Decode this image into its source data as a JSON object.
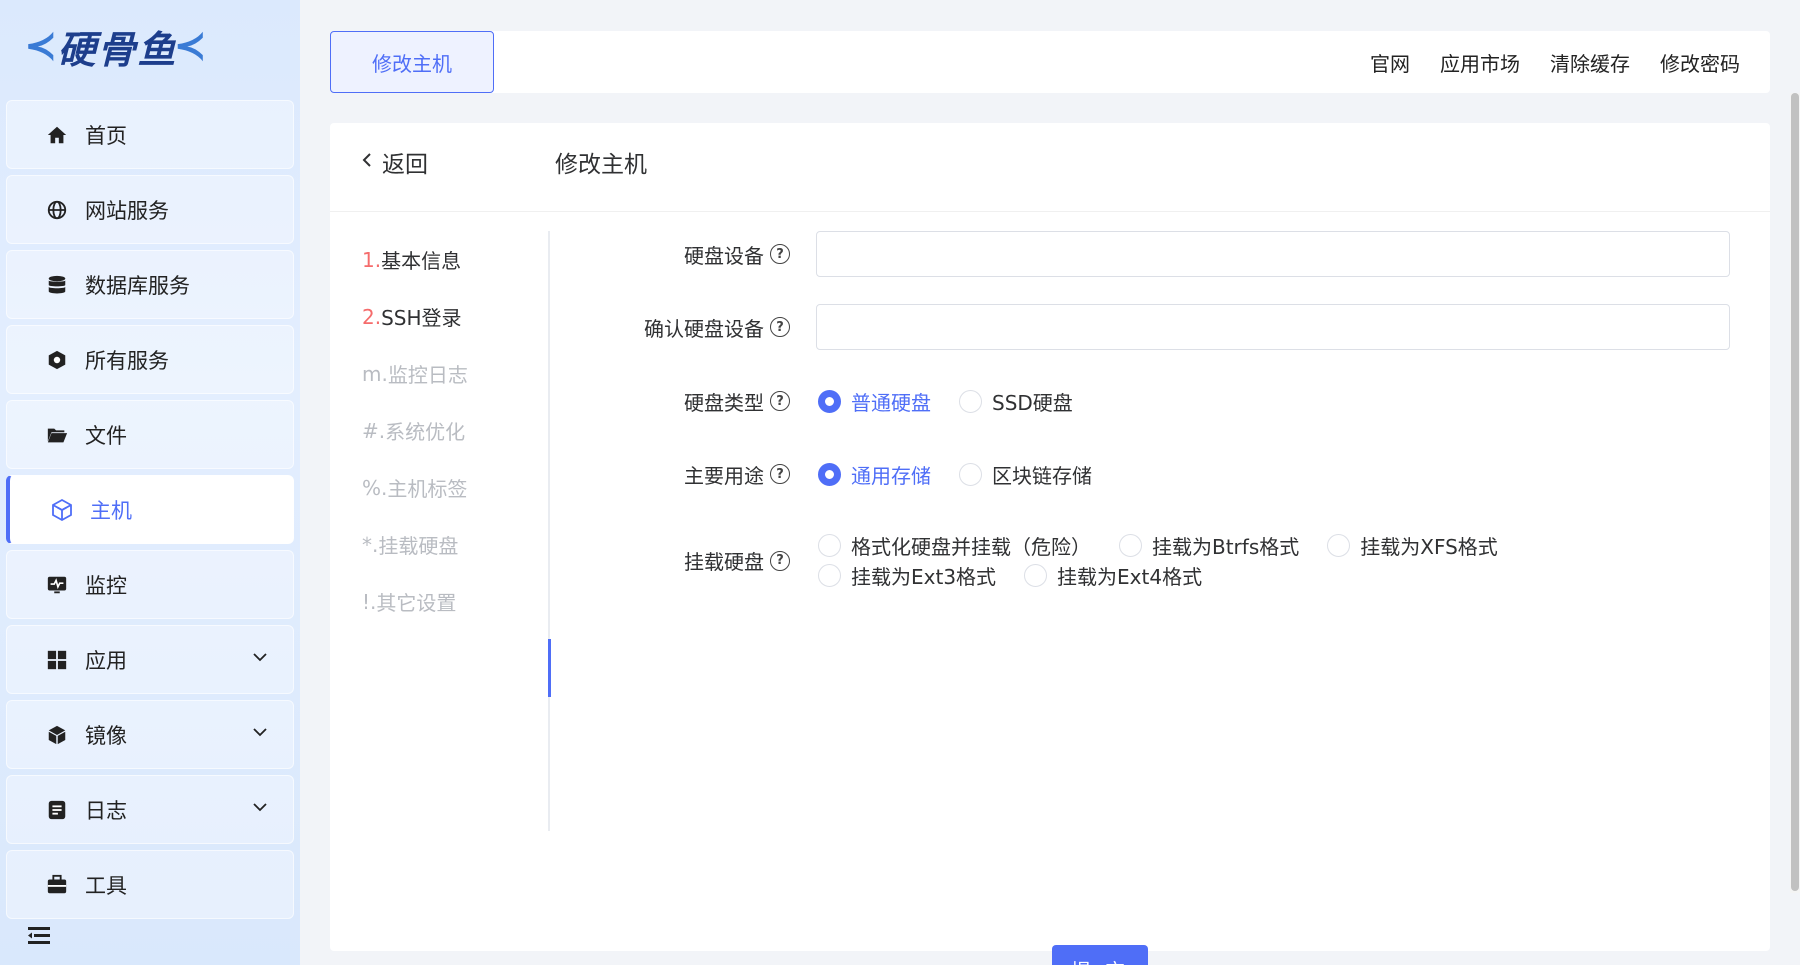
{
  "sidebar": {
    "logo": "硬骨鱼",
    "items": [
      {
        "label": "首页",
        "icon": "home-icon"
      },
      {
        "label": "网站服务",
        "icon": "globe-icon"
      },
      {
        "label": "数据库服务",
        "icon": "database-icon"
      },
      {
        "label": "所有服务",
        "icon": "services-icon"
      },
      {
        "label": "文件",
        "icon": "folder-icon"
      },
      {
        "label": "主机",
        "icon": "host-cube-icon",
        "active": true
      },
      {
        "label": "监控",
        "icon": "monitor-icon"
      },
      {
        "label": "应用",
        "icon": "apps-grid-icon",
        "expandable": true
      },
      {
        "label": "镜像",
        "icon": "box-icon",
        "expandable": true
      },
      {
        "label": "日志",
        "icon": "log-icon",
        "expandable": true
      },
      {
        "label": "工具",
        "icon": "toolbox-icon"
      }
    ]
  },
  "topbar": {
    "active_tab": "修改主机",
    "links": [
      "官网",
      "应用市场",
      "清除缓存",
      "修改密码"
    ]
  },
  "page": {
    "back_label": "返回",
    "title": "修改主机",
    "steps": [
      {
        "prefix": "1.",
        "text": "基本信息",
        "done": true
      },
      {
        "prefix": "2.",
        "text": "SSH登录",
        "done": true
      },
      {
        "prefix": "m.",
        "text": "监控日志",
        "done": false
      },
      {
        "prefix": "#.",
        "text": "系统优化",
        "done": false
      },
      {
        "prefix": "%.",
        "text": "主机标签",
        "done": false
      },
      {
        "prefix": "*.",
        "text": "挂载硬盘",
        "done": false
      },
      {
        "prefix": "!.",
        "text": "其它设置",
        "done": false
      }
    ]
  },
  "form": {
    "disk_device": {
      "label": "硬盘设备",
      "value": ""
    },
    "confirm_disk_device": {
      "label": "确认硬盘设备",
      "value": ""
    },
    "disk_type": {
      "label": "硬盘类型",
      "options": [
        "普通硬盘",
        "SSD硬盘"
      ],
      "selected": "普通硬盘"
    },
    "usage": {
      "label": "主要用途",
      "options": [
        "通用存储",
        "区块链存储"
      ],
      "selected": "通用存储"
    },
    "mount": {
      "label": "挂载硬盘",
      "options": [
        "格式化硬盘并挂载（危险）",
        "挂载为Btrfs格式",
        "挂载为XFS格式",
        "挂载为Ext3格式",
        "挂载为Ext4格式"
      ],
      "selected": ""
    },
    "submit_label": "提 交",
    "help_glyph": "?"
  },
  "colors": {
    "accent": "#4f6ef7",
    "step_red": "#f56c6c"
  }
}
